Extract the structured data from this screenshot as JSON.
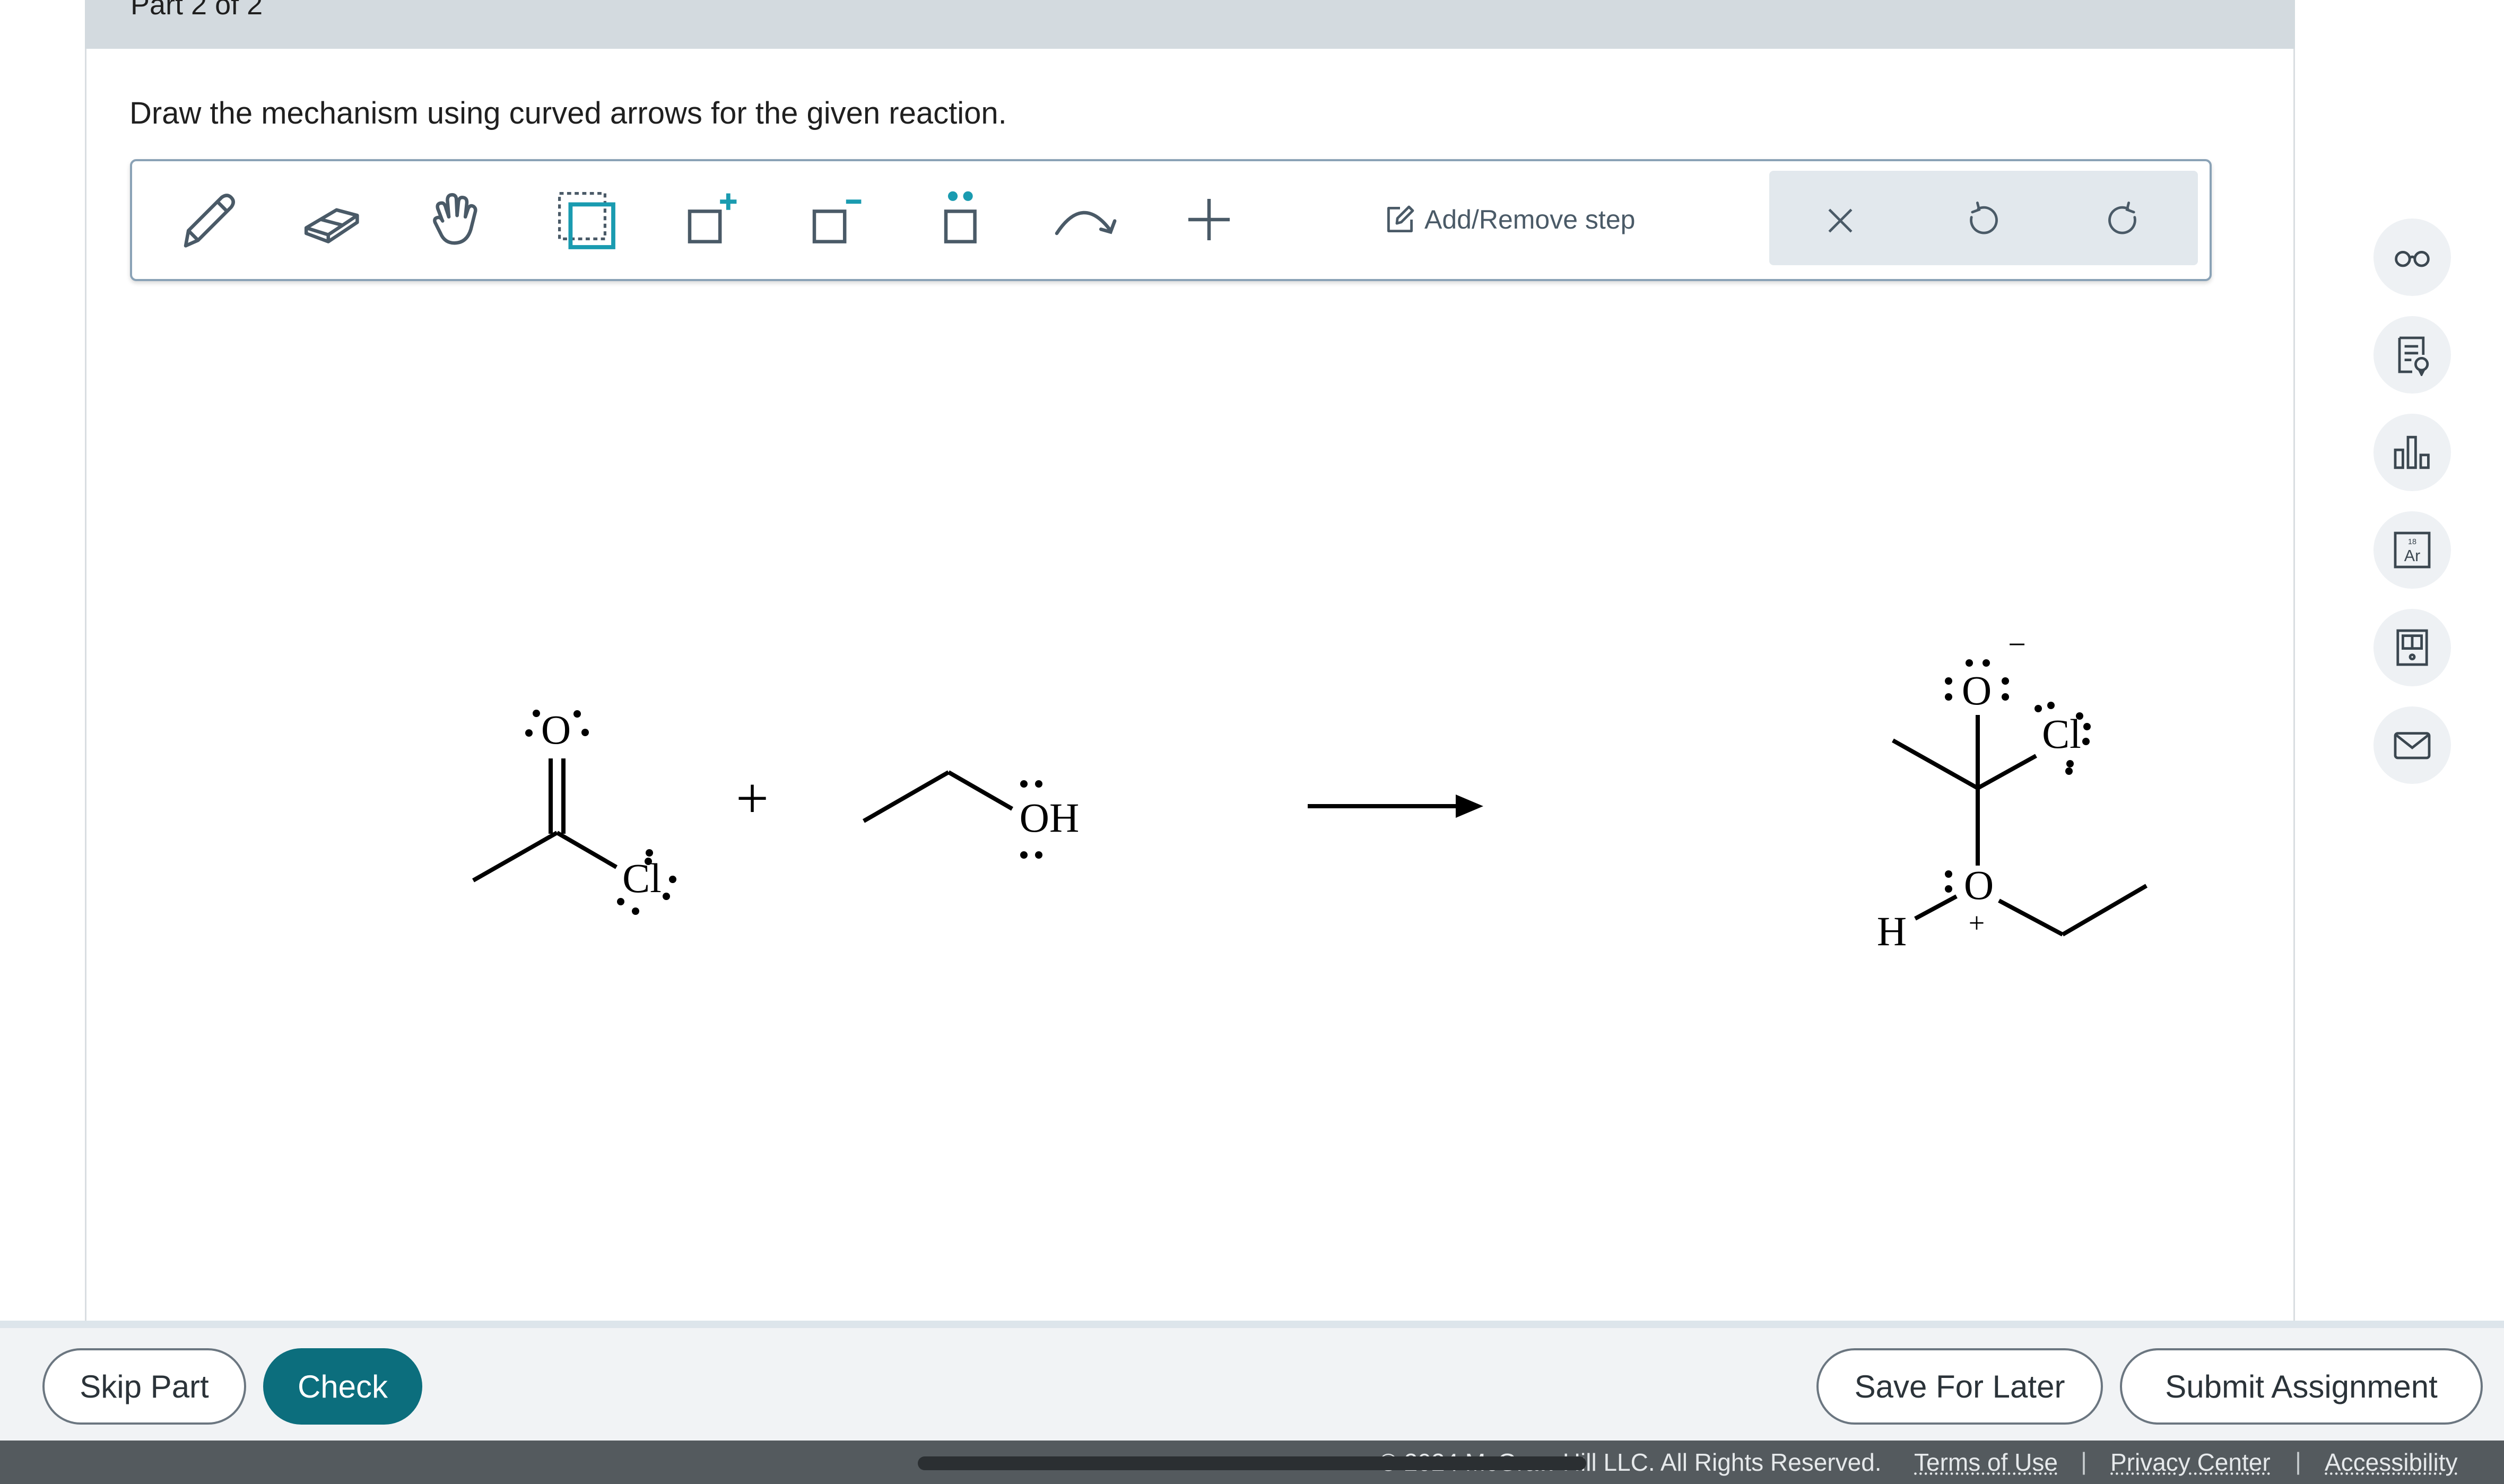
{
  "header": {
    "part_label": "Part 2 of 2"
  },
  "instruction": "Draw the mechanism using curved arrows for the given reaction.",
  "toolbar": {
    "tools": [
      "pencil-icon",
      "eraser-icon",
      "hand-icon",
      "select-icon",
      "add-charge-icon",
      "remove-charge-icon",
      "lone-pair-icon",
      "curved-arrow-icon",
      "plus-icon"
    ],
    "add_remove_step": "Add/Remove step",
    "history": [
      "clear-icon",
      "undo-icon",
      "redo-icon"
    ]
  },
  "reaction": {
    "reactant1": {
      "atoms": [
        "O",
        "Cl"
      ]
    },
    "plus": "+",
    "reactant2": {
      "atoms": [
        "OH"
      ]
    },
    "product": {
      "atoms": [
        "O",
        "Cl",
        "O",
        "H"
      ],
      "charges": [
        "−",
        "+"
      ]
    }
  },
  "side_tools": [
    "glasses-icon",
    "notes-icon",
    "chart-icon",
    "periodic-table-icon",
    "calculator-icon",
    "mail-icon"
  ],
  "periodic": {
    "number": "18",
    "symbol": "Ar"
  },
  "bottom": {
    "skip_part": "Skip Part",
    "check": "Check",
    "save_for_later": "Save For Later",
    "submit_assignment": "Submit Assignment"
  },
  "footer": {
    "copyright": "© 2024 McGraw Hill LLC. All Rights Reserved.",
    "terms": "Terms of Use",
    "privacy": "Privacy Center",
    "accessibility": "Accessibility",
    "sep": "|"
  },
  "colors": {
    "accent": "#0c6e7d",
    "tool_teal": "#1a9bb0",
    "icon_gray": "#4a5a67"
  }
}
